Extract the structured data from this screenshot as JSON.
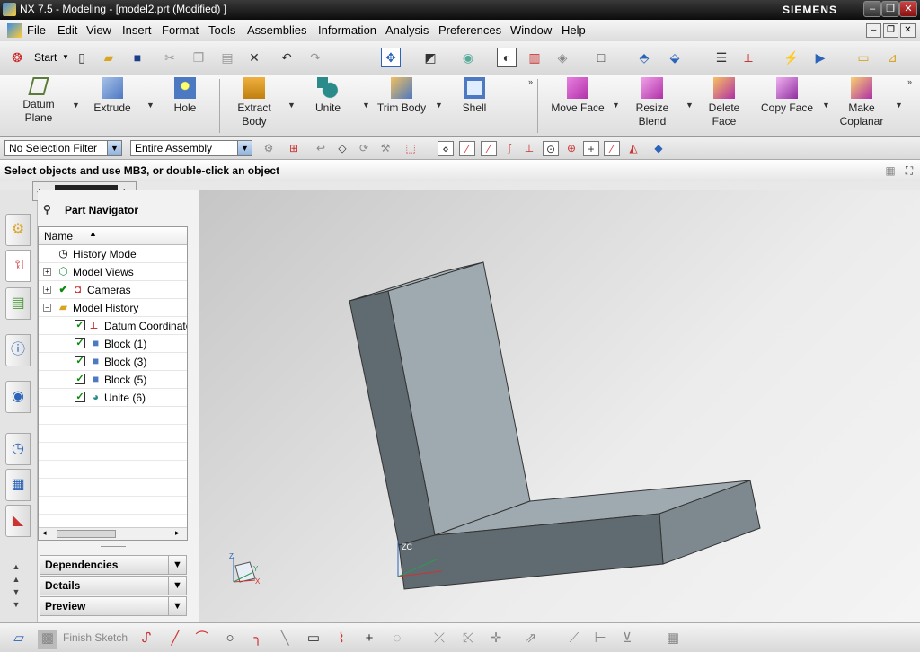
{
  "window": {
    "title": "NX 7.5 - Modeling - [model2.prt (Modified) ]",
    "brand": "SIEMENS"
  },
  "menubar": {
    "items": [
      "File",
      "Edit",
      "View",
      "Insert",
      "Format",
      "Tools",
      "Assemblies",
      "Information",
      "Analysis",
      "Preferences",
      "Window",
      "Help"
    ]
  },
  "standard_toolbar": {
    "start_label": "Start"
  },
  "ribbon": {
    "buttons": [
      {
        "label": "Datum\nPlane"
      },
      {
        "label": "Extrude"
      },
      {
        "label": "Hole"
      },
      {
        "label": "Extract\nBody"
      },
      {
        "label": "Unite"
      },
      {
        "label": "Trim Body"
      },
      {
        "label": "Shell"
      },
      {
        "label": "Move Face"
      },
      {
        "label": "Resize\nBlend"
      },
      {
        "label": "Delete\nFace"
      },
      {
        "label": "Copy Face"
      },
      {
        "label": "Make\nCoplanar"
      }
    ]
  },
  "selection_bar": {
    "filter": "No Selection Filter",
    "scope": "Entire Assembly"
  },
  "cue_line": "Select objects and use MB3, or double-click an object",
  "part_navigator": {
    "title": "Part Navigator",
    "column": "Name",
    "nodes": [
      {
        "label": "History Mode",
        "level": 0,
        "expander": "",
        "checked": false
      },
      {
        "label": "Model Views",
        "level": 0,
        "expander": "+",
        "checked": false
      },
      {
        "label": "Cameras",
        "level": 0,
        "expander": "+",
        "checked": true
      },
      {
        "label": "Model History",
        "level": 0,
        "expander": "−",
        "checked": false
      },
      {
        "label": "Datum Coordinate",
        "level": 1,
        "expander": "",
        "checked": true
      },
      {
        "label": "Block (1)",
        "level": 1,
        "expander": "",
        "checked": true
      },
      {
        "label": "Block (3)",
        "level": 1,
        "expander": "",
        "checked": true
      },
      {
        "label": "Block (5)",
        "level": 1,
        "expander": "",
        "checked": true
      },
      {
        "label": "Unite (6)",
        "level": 1,
        "expander": "",
        "checked": true
      }
    ],
    "panels": [
      "Dependencies",
      "Details",
      "Preview"
    ]
  },
  "viewport": {
    "triad_label": "ZC",
    "axis_z": "Z",
    "axis_y": "Y",
    "axis_x": "X"
  },
  "bottom_toolbar": {
    "finish_sketch": "Finish Sketch"
  },
  "colors": {
    "accent": "#2b64b8",
    "body_face_light": "#9eaab0",
    "body_face_dark": "#5f6b70"
  }
}
